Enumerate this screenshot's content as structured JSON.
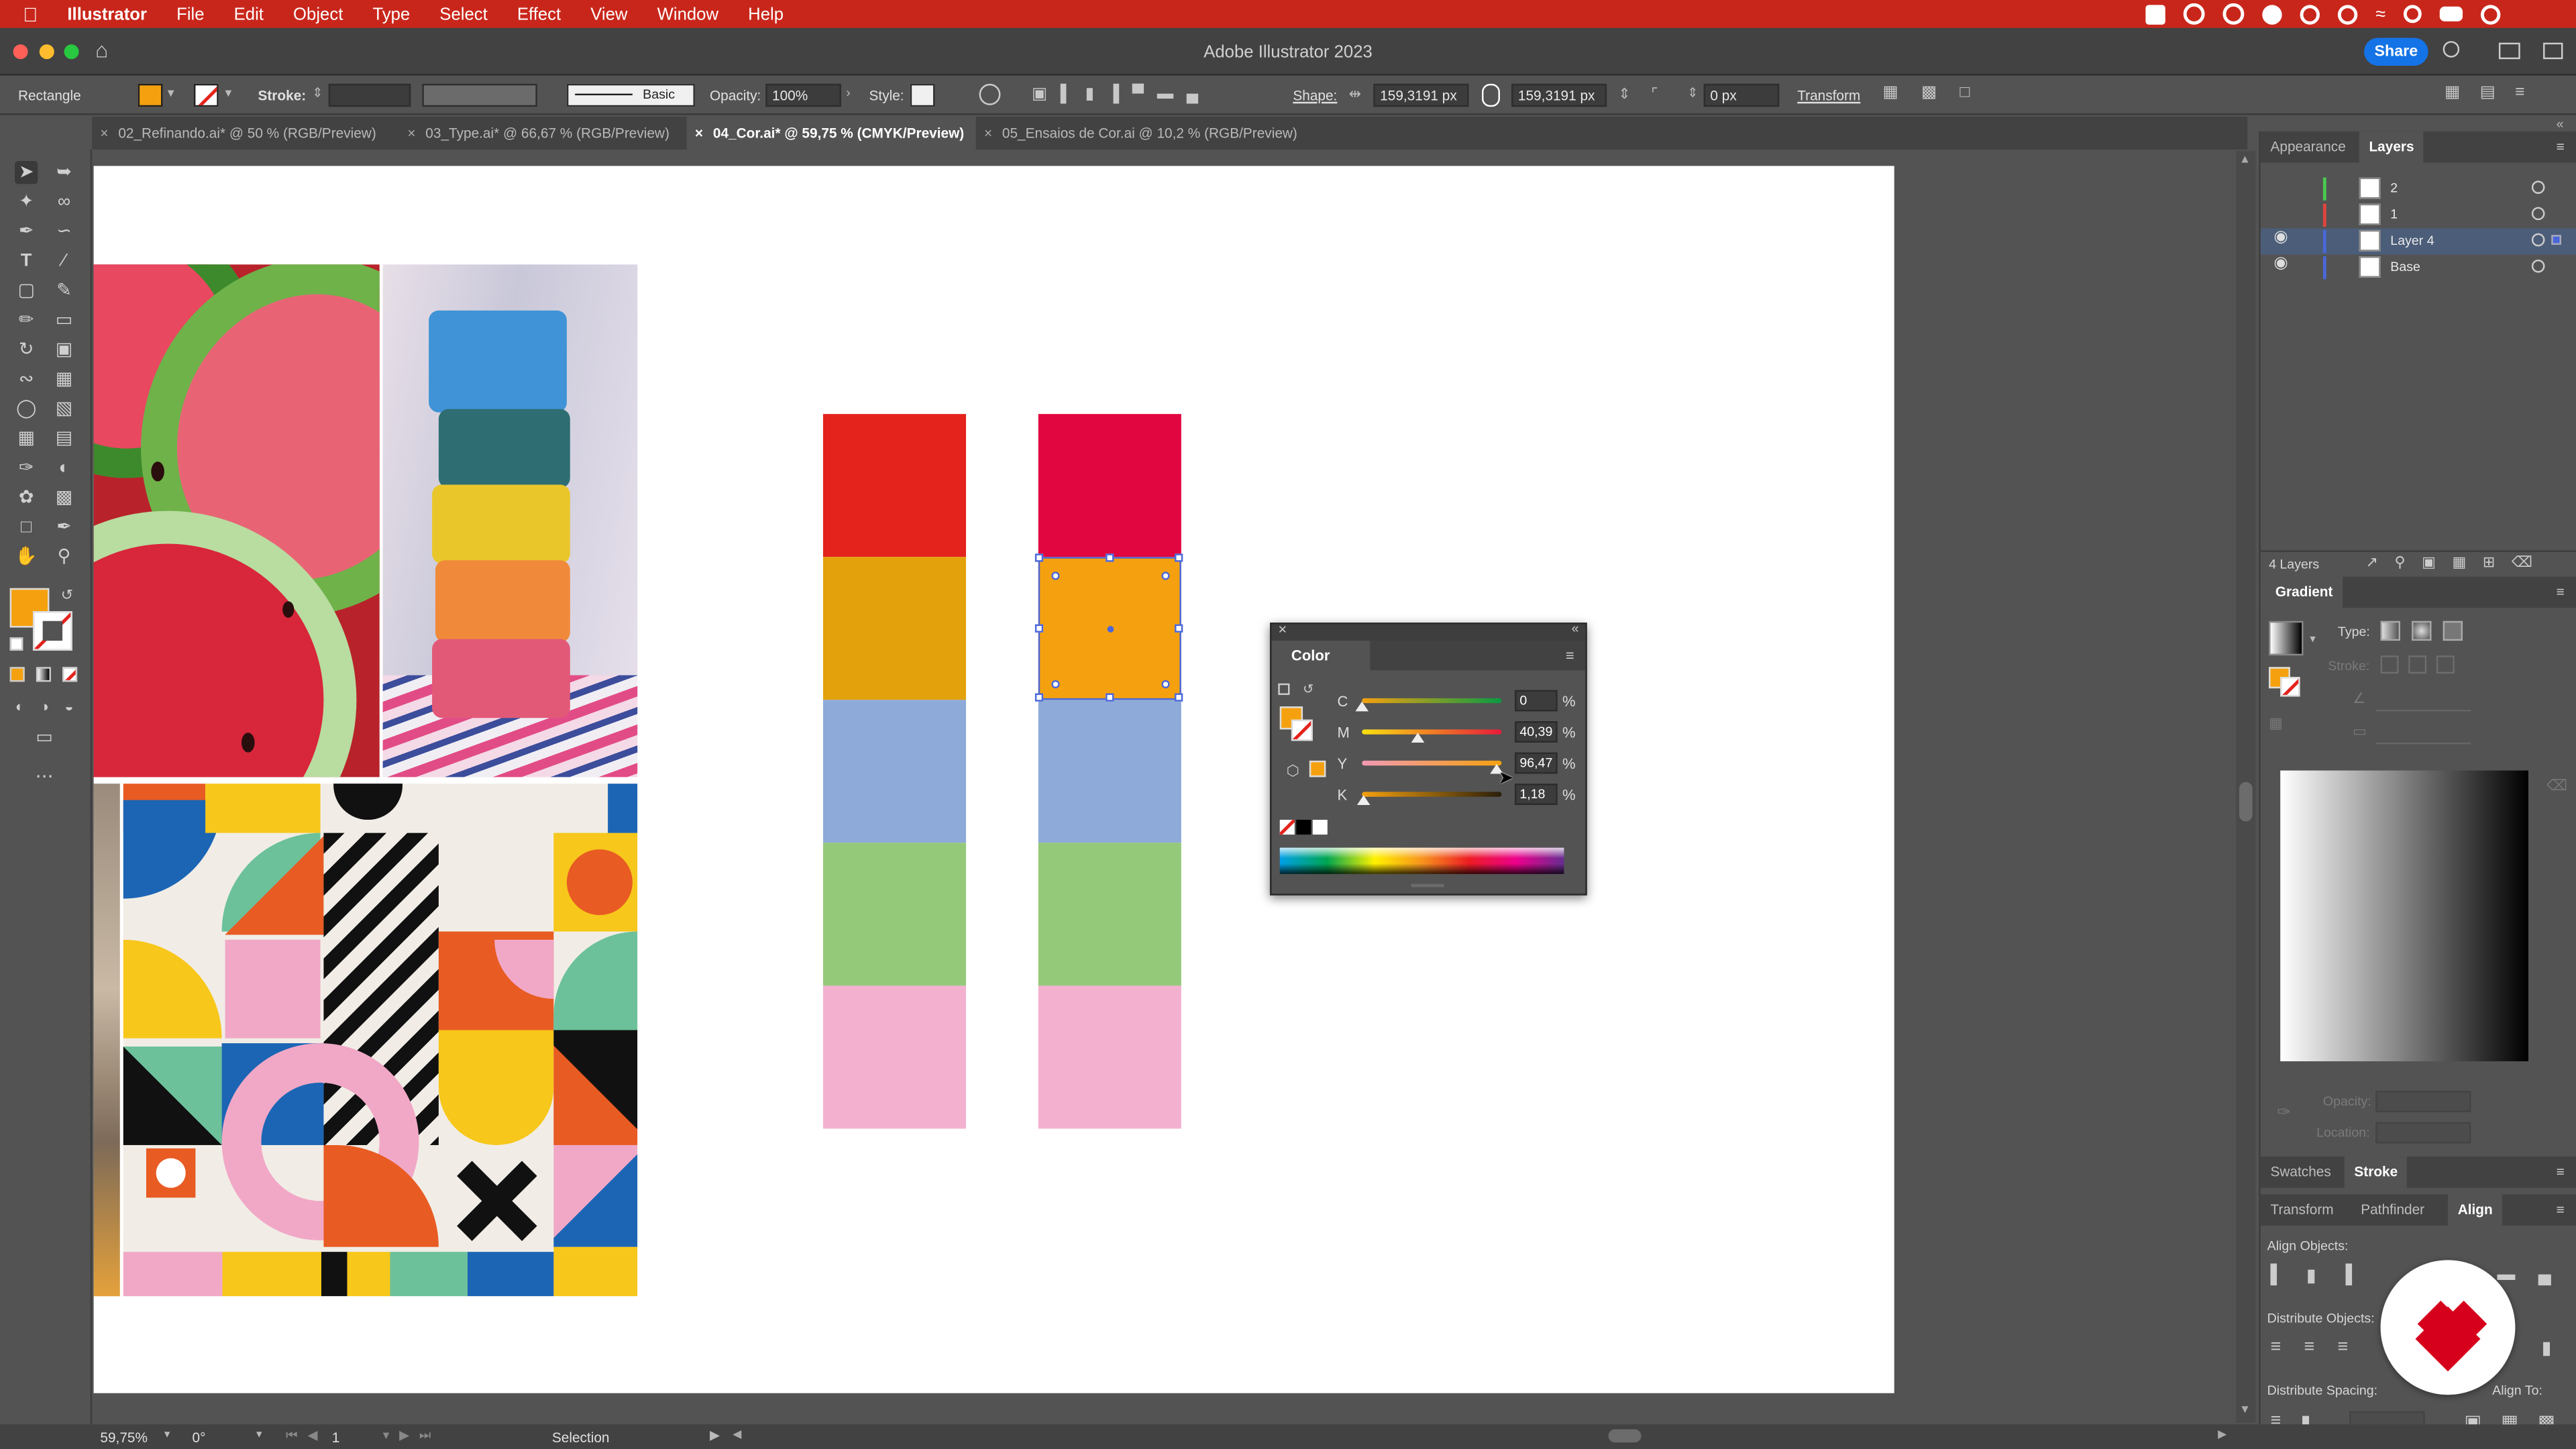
{
  "menubar": {
    "app_name": "Illustrator",
    "items": [
      "File",
      "Edit",
      "Object",
      "Type",
      "Select",
      "Effect",
      "View",
      "Window",
      "Help"
    ]
  },
  "titlebar": {
    "title": "Adobe Illustrator 2023",
    "share_label": "Share"
  },
  "control_bar": {
    "selection_type": "Rectangle",
    "fill_color": "#f5a10f",
    "stroke_label": "Stroke:",
    "brush_label": "Basic",
    "opacity_label": "Opacity:",
    "opacity_value": "100%",
    "style_label": "Style:",
    "shape_label": "Shape:",
    "width_value": "159,3191 px",
    "height_value": "159,3191 px",
    "corner_value": "0 px",
    "transform_label": "Transform"
  },
  "document_tabs": [
    {
      "label": "02_Refinando.ai* @ 50 % (RGB/Preview)",
      "active": false
    },
    {
      "label": "03_Type.ai* @ 66,67 % (RGB/Preview)",
      "active": false
    },
    {
      "label": "04_Cor.ai* @ 59,75 % (CMYK/Preview)",
      "active": true
    },
    {
      "label": "05_Ensaios de Cor.ai @ 10,2 % (RGB/Preview)",
      "active": false
    }
  ],
  "swatches_left": [
    "#e3231c",
    "#e3a10c",
    "#8eaad8",
    "#95c97a",
    "#f4b1cf"
  ],
  "swatches_right": [
    "#e10540",
    "#f5a10f",
    "#8eaad8",
    "#95c97a",
    "#f4b1cf"
  ],
  "color_panel": {
    "title": "Color",
    "channels": [
      {
        "label": "C",
        "value": "0",
        "unit": "%",
        "fraction": 0.0
      },
      {
        "label": "M",
        "value": "40,39",
        "unit": "%",
        "fraction": 0.4039
      },
      {
        "label": "Y",
        "value": "96,47",
        "unit": "%",
        "fraction": 0.9647
      },
      {
        "label": "K",
        "value": "1,18",
        "unit": "%",
        "fraction": 0.0118
      }
    ]
  },
  "layers_panel": {
    "tabs": [
      "Appearance",
      "Layers"
    ],
    "active_tab": "Layers",
    "layers": [
      {
        "name": "2",
        "color": "#49c94f",
        "visible": false
      },
      {
        "name": "1",
        "color": "#e0453d",
        "visible": false
      },
      {
        "name": "Layer 4",
        "color": "#4a67d9",
        "visible": true,
        "selected": true
      },
      {
        "name": "Base",
        "color": "#4a67d9",
        "visible": true
      }
    ],
    "count_label": "4 Layers"
  },
  "gradient_panel": {
    "title": "Gradient",
    "type_label": "Type:",
    "stroke_label": "Stroke:",
    "opacity_label": "Opacity:",
    "location_label": "Location:"
  },
  "swatches_stroke_tabs": [
    "Swatches",
    "Stroke"
  ],
  "align_panel": {
    "tabs": [
      "Transform",
      "Pathfinder",
      "Align"
    ],
    "align_objects_label": "Align Objects:",
    "distribute_objects_label": "Distribute Objects:",
    "distribute_spacing_label": "Distribute Spacing:",
    "align_to_label": "Align To:"
  },
  "statusbar": {
    "zoom": "59,75%",
    "rotation": "0°",
    "artboard": "1",
    "tool": "Selection"
  }
}
